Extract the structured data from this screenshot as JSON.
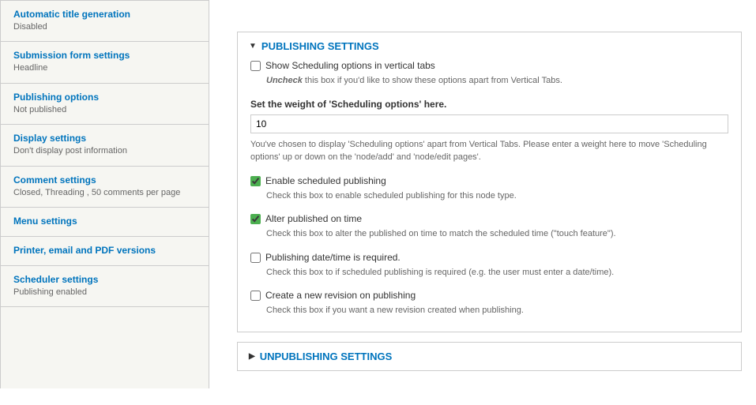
{
  "sidebar": {
    "items": [
      {
        "label": "Automatic title generation",
        "sub": "Disabled"
      },
      {
        "label": "Submission form settings",
        "sub": "Headline"
      },
      {
        "label": "Publishing options",
        "sub": "Not published"
      },
      {
        "label": "Display settings",
        "sub": "Don't display post information"
      },
      {
        "label": "Comment settings",
        "sub": "Closed, Threading , 50 comments per page"
      },
      {
        "label": "Menu settings",
        "sub": ""
      },
      {
        "label": "Printer, email and PDF versions",
        "sub": ""
      },
      {
        "label": "Scheduler settings",
        "sub": "Publishing enabled"
      }
    ]
  },
  "publishing": {
    "legend": "Publishing Settings",
    "show_tabs": {
      "label": "Show Scheduling options in vertical tabs",
      "desc_prefix": "Uncheck",
      "desc_rest": " this box if you'd like to show these options apart from Vertical Tabs."
    },
    "weight": {
      "label": "Set the weight of 'Scheduling options' here.",
      "value": "10",
      "help": "You've chosen to display 'Scheduling options' apart from Vertical Tabs. Please enter a weight here to move 'Scheduling options' up or down on the 'node/add' and 'node/edit pages'."
    },
    "enable": {
      "label": "Enable scheduled publishing",
      "desc": "Check this box to enable scheduled publishing for this node type."
    },
    "alter": {
      "label": "Alter published on time",
      "desc": "Check this box to alter the published on time to match the scheduled time (\"touch feature\")."
    },
    "required": {
      "label": "Publishing date/time is required.",
      "desc": "Check this box to if scheduled publishing is required (e.g. the user must enter a date/time)."
    },
    "revision": {
      "label": "Create a new revision on publishing",
      "desc": "Check this box if you want a new revision created when publishing."
    }
  },
  "unpublishing": {
    "legend": "Unpublishing Settings"
  }
}
